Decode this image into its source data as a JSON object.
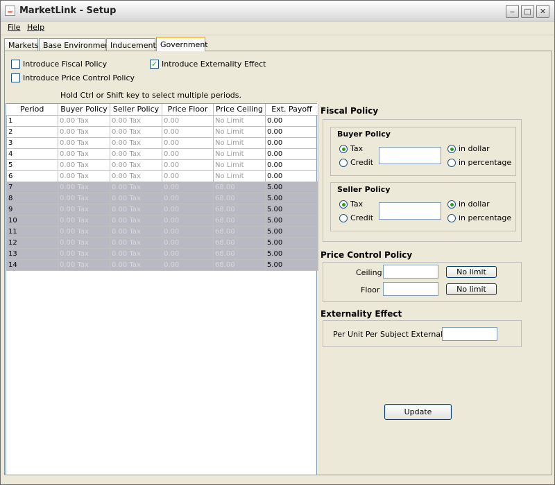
{
  "window": {
    "title": "MarketLink - Setup",
    "minimize": "‒",
    "maximize": "□",
    "close": "✕",
    "app_icon": "java-cup-icon"
  },
  "menu": {
    "file": "File",
    "help": "Help"
  },
  "tabs": [
    "Markets",
    "Base Environment",
    "Inducements",
    "Government"
  ],
  "active_tab": "Government",
  "options": {
    "fiscal": {
      "label": "Introduce Fiscal Policy",
      "checked": false
    },
    "price_control": {
      "label": "Introduce Price Control Policy",
      "checked": false
    },
    "externality": {
      "label": "Introduce Externality Effect",
      "checked": true,
      "mark": "✓"
    }
  },
  "hint": "Hold Ctrl or Shift key to select multiple periods.",
  "table": {
    "columns": [
      "Period",
      "Buyer Policy",
      "Seller Policy",
      "Price Floor",
      "Price Ceiling",
      "Ext. Payoff"
    ],
    "rows": [
      [
        "1",
        "0.00 Tax",
        "0.00 Tax",
        "0.00",
        "No Limit",
        "0.00"
      ],
      [
        "2",
        "0.00 Tax",
        "0.00 Tax",
        "0.00",
        "No Limit",
        "0.00"
      ],
      [
        "3",
        "0.00 Tax",
        "0.00 Tax",
        "0.00",
        "No Limit",
        "0.00"
      ],
      [
        "4",
        "0.00 Tax",
        "0.00 Tax",
        "0.00",
        "No Limit",
        "0.00"
      ],
      [
        "5",
        "0.00 Tax",
        "0.00 Tax",
        "0.00",
        "No Limit",
        "0.00"
      ],
      [
        "6",
        "0.00 Tax",
        "0.00 Tax",
        "0.00",
        "No Limit",
        "0.00"
      ],
      [
        "7",
        "0.00 Tax",
        "0.00 Tax",
        "0.00",
        "68.00",
        "5.00"
      ],
      [
        "8",
        "0.00 Tax",
        "0.00 Tax",
        "0.00",
        "68.00",
        "5.00"
      ],
      [
        "9",
        "0.00 Tax",
        "0.00 Tax",
        "0.00",
        "68.00",
        "5.00"
      ],
      [
        "10",
        "0.00 Tax",
        "0.00 Tax",
        "0.00",
        "68.00",
        "5.00"
      ],
      [
        "11",
        "0.00 Tax",
        "0.00 Tax",
        "0.00",
        "68.00",
        "5.00"
      ],
      [
        "12",
        "0.00 Tax",
        "0.00 Tax",
        "0.00",
        "68.00",
        "5.00"
      ],
      [
        "13",
        "0.00 Tax",
        "0.00 Tax",
        "0.00",
        "68.00",
        "5.00"
      ],
      [
        "14",
        "0.00 Tax",
        "0.00 Tax",
        "0.00",
        "68.00",
        "5.00"
      ]
    ]
  },
  "fiscal_policy": {
    "title": "Fiscal Policy",
    "buyer": {
      "title": "Buyer Policy",
      "tax": "Tax",
      "credit": "Credit",
      "dollar": "in dollar",
      "percent": "in percentage",
      "value": ""
    },
    "seller": {
      "title": "Seller Policy",
      "tax": "Tax",
      "credit": "Credit",
      "dollar": "in dollar",
      "percent": "in percentage",
      "value": ""
    }
  },
  "price_control": {
    "title": "Price Control Policy",
    "ceiling": "Ceiling",
    "floor": "Floor",
    "no_limit": "No limit",
    "ceiling_value": "",
    "floor_value": ""
  },
  "externality": {
    "title": "Externality Effect",
    "label": "Per Unit Per Subject Externality",
    "value": ""
  },
  "update_button": "Update",
  "colors": {
    "selected_row": "#b8b9c2",
    "active_tab_accent": "#ffc83c",
    "check_green": "#21a121"
  }
}
